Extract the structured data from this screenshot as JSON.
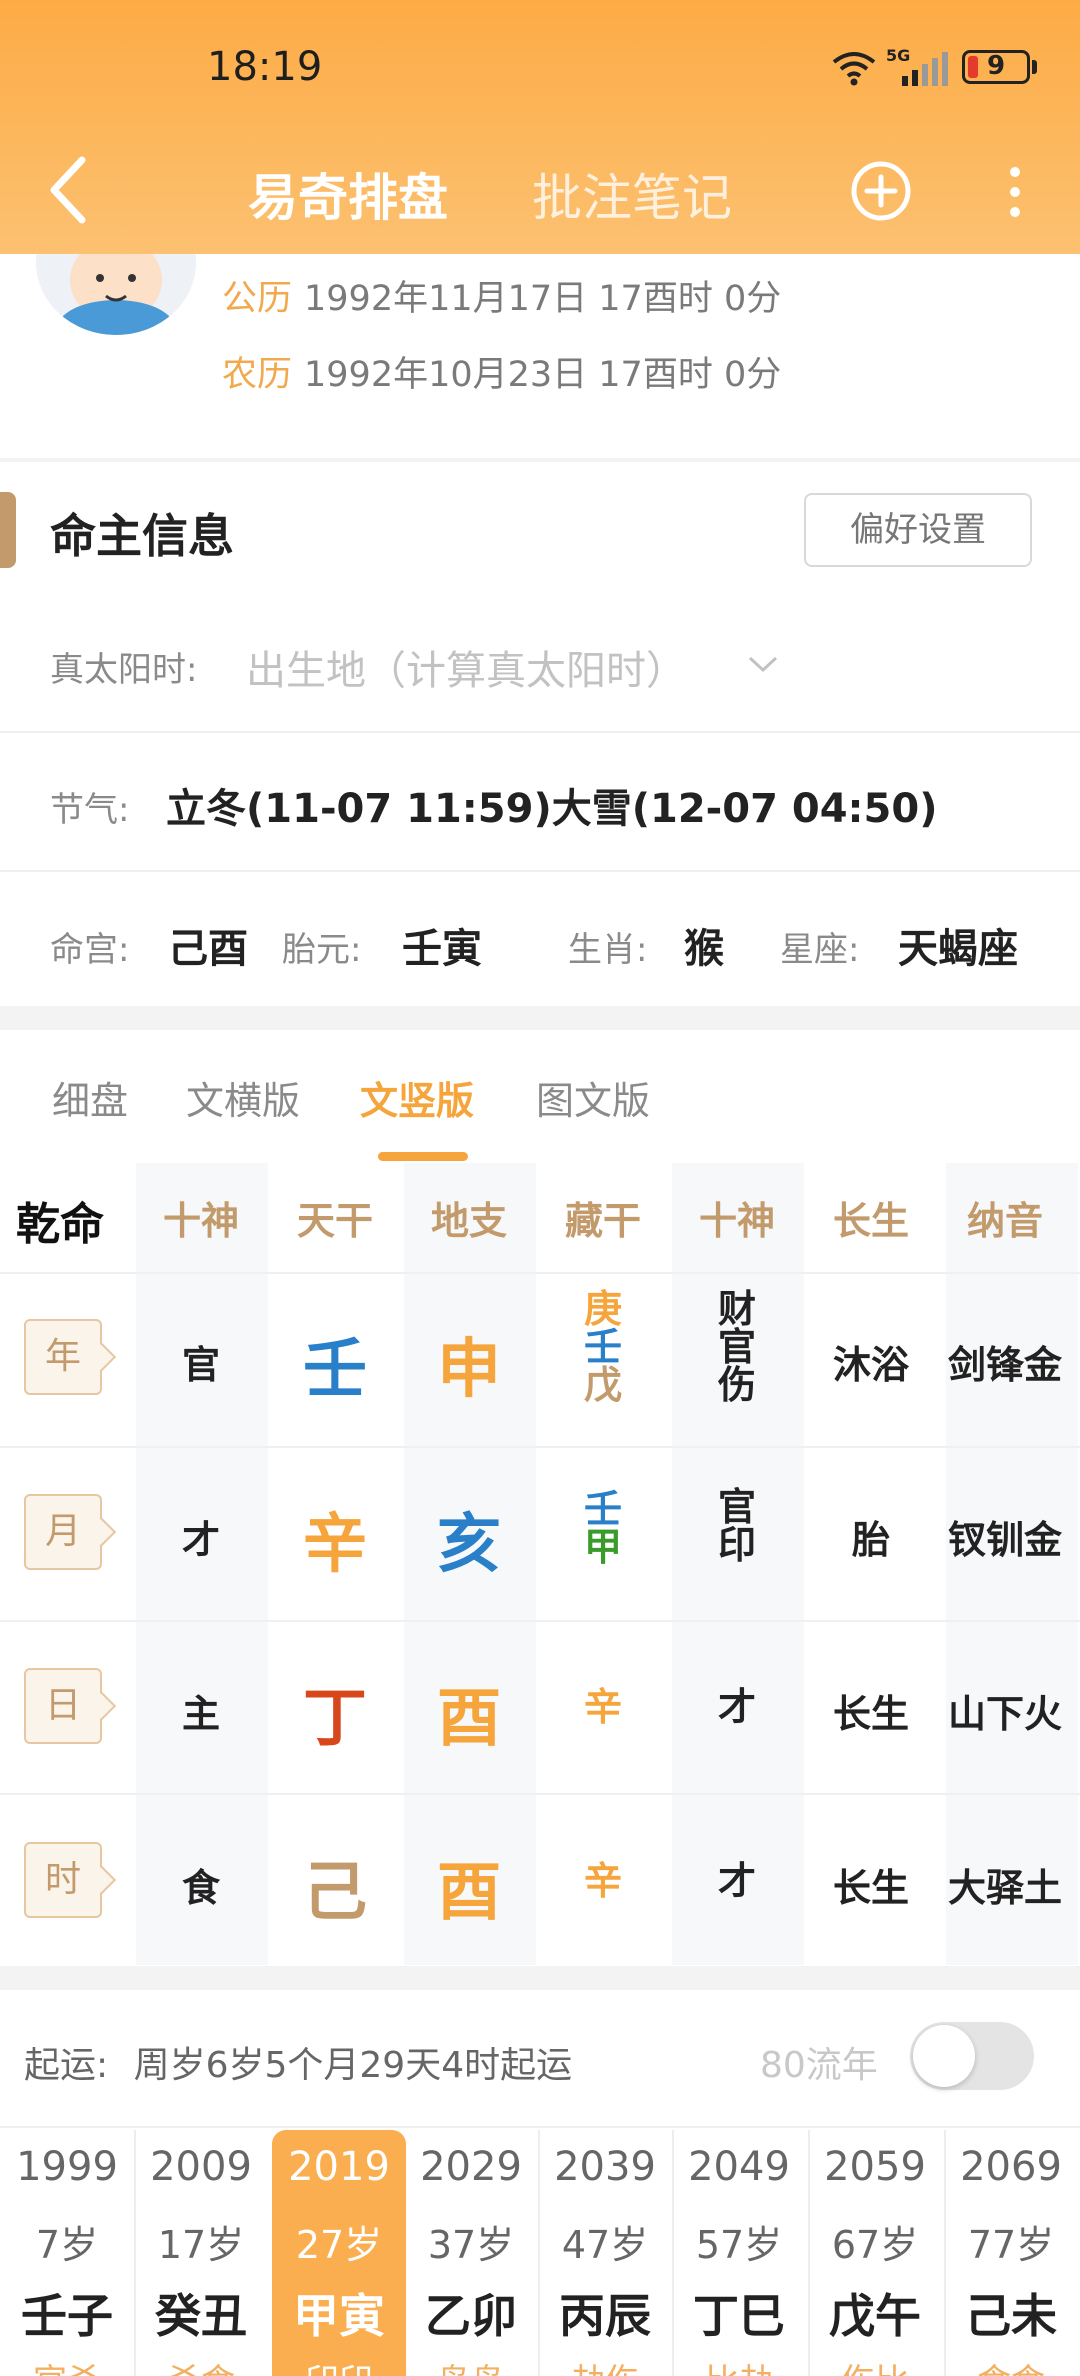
{
  "status": {
    "time": "18:19",
    "network": "5G",
    "battery": "9"
  },
  "nav": {
    "tab_active": "易奇排盘",
    "tab_other": "批注笔记"
  },
  "profile": {
    "solar_label": "公历",
    "solar_date": "1992年11月17日 17酉时 0分",
    "lunar_label": "农历",
    "lunar_date": "1992年10月23日 17酉时 0分"
  },
  "section": {
    "title": "命主信息",
    "pref_button": "偏好设置"
  },
  "info": {
    "solar_time_label": "真太阳时:",
    "solar_time_placeholder": "出生地（计算真太阳时）",
    "jieqi_label": "节气:",
    "jieqi_value": "立冬(11-07 11:59)大雪(12-07 04:50)",
    "minggong_label": "命宫:",
    "minggong_value": "己酉",
    "taiyuan_label": "胎元:",
    "taiyuan_value": "壬寅",
    "shengxiao_label": "生肖:",
    "shengxiao_value": "猴",
    "xingzuo_label": "星座:",
    "xingzuo_value": "天蝎座"
  },
  "chart_tabs": [
    "细盘",
    "文横版",
    "文竖版",
    "图文版"
  ],
  "grid": {
    "gender_label": "乾命",
    "headers": [
      "十神",
      "天干",
      "地支",
      "藏干",
      "十神",
      "长生",
      "纳音"
    ],
    "rows": [
      {
        "tag": "年",
        "shishen": "官",
        "tiangan": "壬",
        "dizhi": "申",
        "canggan": [
          "庚",
          "壬",
          "戊"
        ],
        "canggan_shen": [
          "财",
          "官",
          "伤"
        ],
        "changsheng": "沐浴",
        "nayin": "剑锋金"
      },
      {
        "tag": "月",
        "shishen": "才",
        "tiangan": "辛",
        "dizhi": "亥",
        "canggan": [
          "壬",
          "甲"
        ],
        "canggan_shen": [
          "官",
          "印"
        ],
        "changsheng": "胎",
        "nayin": "钗钏金"
      },
      {
        "tag": "日",
        "shishen": "主",
        "tiangan": "丁",
        "dizhi": "酉",
        "canggan": [
          "辛"
        ],
        "canggan_shen": [
          "才"
        ],
        "changsheng": "长生",
        "nayin": "山下火"
      },
      {
        "tag": "时",
        "shishen": "食",
        "tiangan": "己",
        "dizhi": "酉",
        "canggan": [
          "辛"
        ],
        "canggan_shen": [
          "才"
        ],
        "changsheng": "长生",
        "nayin": "大驿土"
      }
    ],
    "colors": {
      "water": "#2a7fc9",
      "metal": "#f5a53c",
      "fire": "#d8461c",
      "earth": "#c29a6b",
      "wood": "#3a9a2a"
    }
  },
  "qiyun": {
    "label": "起运:",
    "text": "周岁6岁5个月29天4时起运",
    "flow_label": "80流年"
  },
  "dayun": [
    {
      "year": "1999",
      "age": "7岁",
      "ganzhi": "壬子",
      "sub": "官杀"
    },
    {
      "year": "2009",
      "age": "17岁",
      "ganzhi": "癸丑",
      "sub": "杀食"
    },
    {
      "year": "2019",
      "age": "27岁",
      "ganzhi": "甲寅",
      "sub": "印印"
    },
    {
      "year": "2029",
      "age": "37岁",
      "ganzhi": "乙卯",
      "sub": "枭枭"
    },
    {
      "year": "2039",
      "age": "47岁",
      "ganzhi": "丙辰",
      "sub": "劫伤"
    },
    {
      "year": "2049",
      "age": "57岁",
      "ganzhi": "丁巳",
      "sub": "比劫"
    },
    {
      "year": "2059",
      "age": "67岁",
      "ganzhi": "戊午",
      "sub": "伤比"
    },
    {
      "year": "2069",
      "age": "77岁",
      "ganzhi": "己未",
      "sub": "食食"
    }
  ]
}
